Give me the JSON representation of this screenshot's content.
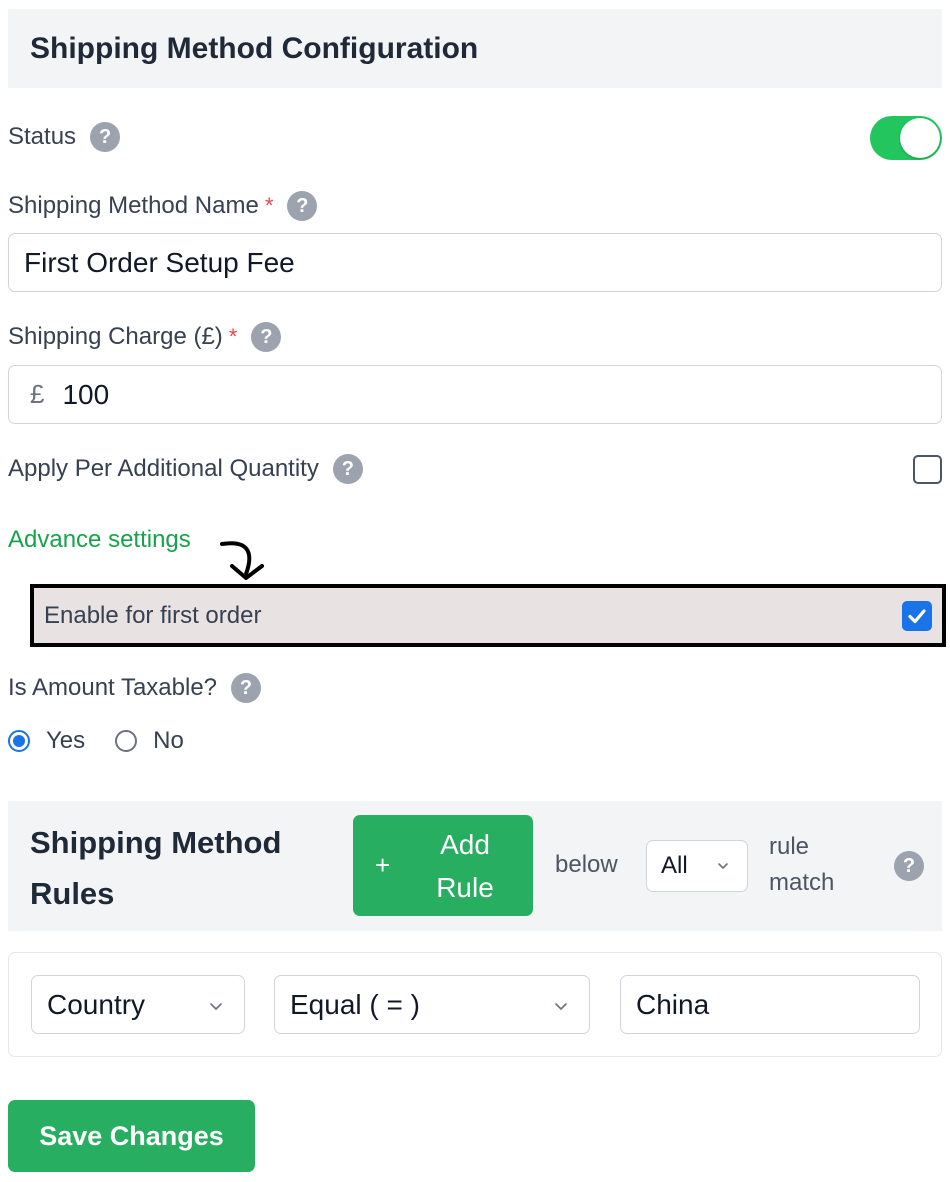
{
  "header": {
    "title": "Shipping Method Configuration"
  },
  "status": {
    "label": "Status",
    "enabled": true
  },
  "method_name": {
    "label": "Shipping Method Name",
    "required_mark": "*",
    "value": "First Order Setup Fee"
  },
  "shipping_charge": {
    "label": "Shipping Charge (£)",
    "required_mark": "*",
    "currency_symbol": "£",
    "value": "100"
  },
  "apply_per_quantity": {
    "label": "Apply Per Additional Quantity",
    "checked": false
  },
  "advance_settings": {
    "link_text": "Advance settings"
  },
  "first_order": {
    "label": "Enable for first order",
    "checked": true
  },
  "taxable": {
    "label": "Is Amount Taxable?",
    "options": [
      {
        "label": "Yes",
        "selected": true
      },
      {
        "label": "No",
        "selected": false
      }
    ]
  },
  "rules": {
    "title": "Shipping Method Rules",
    "add_rule_plus": "+",
    "add_rule_label": "Add Rule",
    "below_text": "below",
    "match_select": "All",
    "rule_match_text": "rule match",
    "items": [
      {
        "field": "Country",
        "operator": "Equal ( = )",
        "value": "China"
      }
    ]
  },
  "save_button": {
    "label": "Save Changes"
  },
  "colors": {
    "accent_green": "#27ae60",
    "toggle_green": "#22c55e",
    "link_green": "#16a34a",
    "checkbox_blue": "#1a73e8",
    "required_red": "#ef4444"
  }
}
